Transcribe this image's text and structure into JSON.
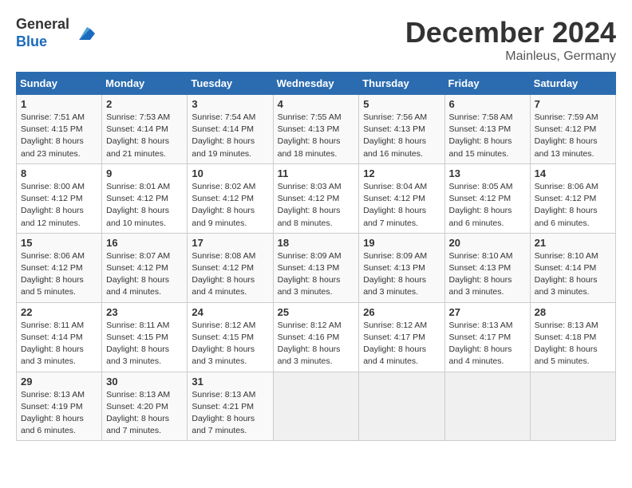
{
  "header": {
    "logo_line1": "General",
    "logo_line2": "Blue",
    "month": "December 2024",
    "location": "Mainleus, Germany"
  },
  "weekdays": [
    "Sunday",
    "Monday",
    "Tuesday",
    "Wednesday",
    "Thursday",
    "Friday",
    "Saturday"
  ],
  "weeks": [
    [
      {
        "day": "1",
        "sunrise": "Sunrise: 7:51 AM",
        "sunset": "Sunset: 4:15 PM",
        "daylight": "Daylight: 8 hours and 23 minutes."
      },
      {
        "day": "2",
        "sunrise": "Sunrise: 7:53 AM",
        "sunset": "Sunset: 4:14 PM",
        "daylight": "Daylight: 8 hours and 21 minutes."
      },
      {
        "day": "3",
        "sunrise": "Sunrise: 7:54 AM",
        "sunset": "Sunset: 4:14 PM",
        "daylight": "Daylight: 8 hours and 19 minutes."
      },
      {
        "day": "4",
        "sunrise": "Sunrise: 7:55 AM",
        "sunset": "Sunset: 4:13 PM",
        "daylight": "Daylight: 8 hours and 18 minutes."
      },
      {
        "day": "5",
        "sunrise": "Sunrise: 7:56 AM",
        "sunset": "Sunset: 4:13 PM",
        "daylight": "Daylight: 8 hours and 16 minutes."
      },
      {
        "day": "6",
        "sunrise": "Sunrise: 7:58 AM",
        "sunset": "Sunset: 4:13 PM",
        "daylight": "Daylight: 8 hours and 15 minutes."
      },
      {
        "day": "7",
        "sunrise": "Sunrise: 7:59 AM",
        "sunset": "Sunset: 4:12 PM",
        "daylight": "Daylight: 8 hours and 13 minutes."
      }
    ],
    [
      {
        "day": "8",
        "sunrise": "Sunrise: 8:00 AM",
        "sunset": "Sunset: 4:12 PM",
        "daylight": "Daylight: 8 hours and 12 minutes."
      },
      {
        "day": "9",
        "sunrise": "Sunrise: 8:01 AM",
        "sunset": "Sunset: 4:12 PM",
        "daylight": "Daylight: 8 hours and 10 minutes."
      },
      {
        "day": "10",
        "sunrise": "Sunrise: 8:02 AM",
        "sunset": "Sunset: 4:12 PM",
        "daylight": "Daylight: 8 hours and 9 minutes."
      },
      {
        "day": "11",
        "sunrise": "Sunrise: 8:03 AM",
        "sunset": "Sunset: 4:12 PM",
        "daylight": "Daylight: 8 hours and 8 minutes."
      },
      {
        "day": "12",
        "sunrise": "Sunrise: 8:04 AM",
        "sunset": "Sunset: 4:12 PM",
        "daylight": "Daylight: 8 hours and 7 minutes."
      },
      {
        "day": "13",
        "sunrise": "Sunrise: 8:05 AM",
        "sunset": "Sunset: 4:12 PM",
        "daylight": "Daylight: 8 hours and 6 minutes."
      },
      {
        "day": "14",
        "sunrise": "Sunrise: 8:06 AM",
        "sunset": "Sunset: 4:12 PM",
        "daylight": "Daylight: 8 hours and 6 minutes."
      }
    ],
    [
      {
        "day": "15",
        "sunrise": "Sunrise: 8:06 AM",
        "sunset": "Sunset: 4:12 PM",
        "daylight": "Daylight: 8 hours and 5 minutes."
      },
      {
        "day": "16",
        "sunrise": "Sunrise: 8:07 AM",
        "sunset": "Sunset: 4:12 PM",
        "daylight": "Daylight: 8 hours and 4 minutes."
      },
      {
        "day": "17",
        "sunrise": "Sunrise: 8:08 AM",
        "sunset": "Sunset: 4:12 PM",
        "daylight": "Daylight: 8 hours and 4 minutes."
      },
      {
        "day": "18",
        "sunrise": "Sunrise: 8:09 AM",
        "sunset": "Sunset: 4:13 PM",
        "daylight": "Daylight: 8 hours and 3 minutes."
      },
      {
        "day": "19",
        "sunrise": "Sunrise: 8:09 AM",
        "sunset": "Sunset: 4:13 PM",
        "daylight": "Daylight: 8 hours and 3 minutes."
      },
      {
        "day": "20",
        "sunrise": "Sunrise: 8:10 AM",
        "sunset": "Sunset: 4:13 PM",
        "daylight": "Daylight: 8 hours and 3 minutes."
      },
      {
        "day": "21",
        "sunrise": "Sunrise: 8:10 AM",
        "sunset": "Sunset: 4:14 PM",
        "daylight": "Daylight: 8 hours and 3 minutes."
      }
    ],
    [
      {
        "day": "22",
        "sunrise": "Sunrise: 8:11 AM",
        "sunset": "Sunset: 4:14 PM",
        "daylight": "Daylight: 8 hours and 3 minutes."
      },
      {
        "day": "23",
        "sunrise": "Sunrise: 8:11 AM",
        "sunset": "Sunset: 4:15 PM",
        "daylight": "Daylight: 8 hours and 3 minutes."
      },
      {
        "day": "24",
        "sunrise": "Sunrise: 8:12 AM",
        "sunset": "Sunset: 4:15 PM",
        "daylight": "Daylight: 8 hours and 3 minutes."
      },
      {
        "day": "25",
        "sunrise": "Sunrise: 8:12 AM",
        "sunset": "Sunset: 4:16 PM",
        "daylight": "Daylight: 8 hours and 3 minutes."
      },
      {
        "day": "26",
        "sunrise": "Sunrise: 8:12 AM",
        "sunset": "Sunset: 4:17 PM",
        "daylight": "Daylight: 8 hours and 4 minutes."
      },
      {
        "day": "27",
        "sunrise": "Sunrise: 8:13 AM",
        "sunset": "Sunset: 4:17 PM",
        "daylight": "Daylight: 8 hours and 4 minutes."
      },
      {
        "day": "28",
        "sunrise": "Sunrise: 8:13 AM",
        "sunset": "Sunset: 4:18 PM",
        "daylight": "Daylight: 8 hours and 5 minutes."
      }
    ],
    [
      {
        "day": "29",
        "sunrise": "Sunrise: 8:13 AM",
        "sunset": "Sunset: 4:19 PM",
        "daylight": "Daylight: 8 hours and 6 minutes."
      },
      {
        "day": "30",
        "sunrise": "Sunrise: 8:13 AM",
        "sunset": "Sunset: 4:20 PM",
        "daylight": "Daylight: 8 hours and 7 minutes."
      },
      {
        "day": "31",
        "sunrise": "Sunrise: 8:13 AM",
        "sunset": "Sunset: 4:21 PM",
        "daylight": "Daylight: 8 hours and 7 minutes."
      },
      null,
      null,
      null,
      null
    ]
  ]
}
